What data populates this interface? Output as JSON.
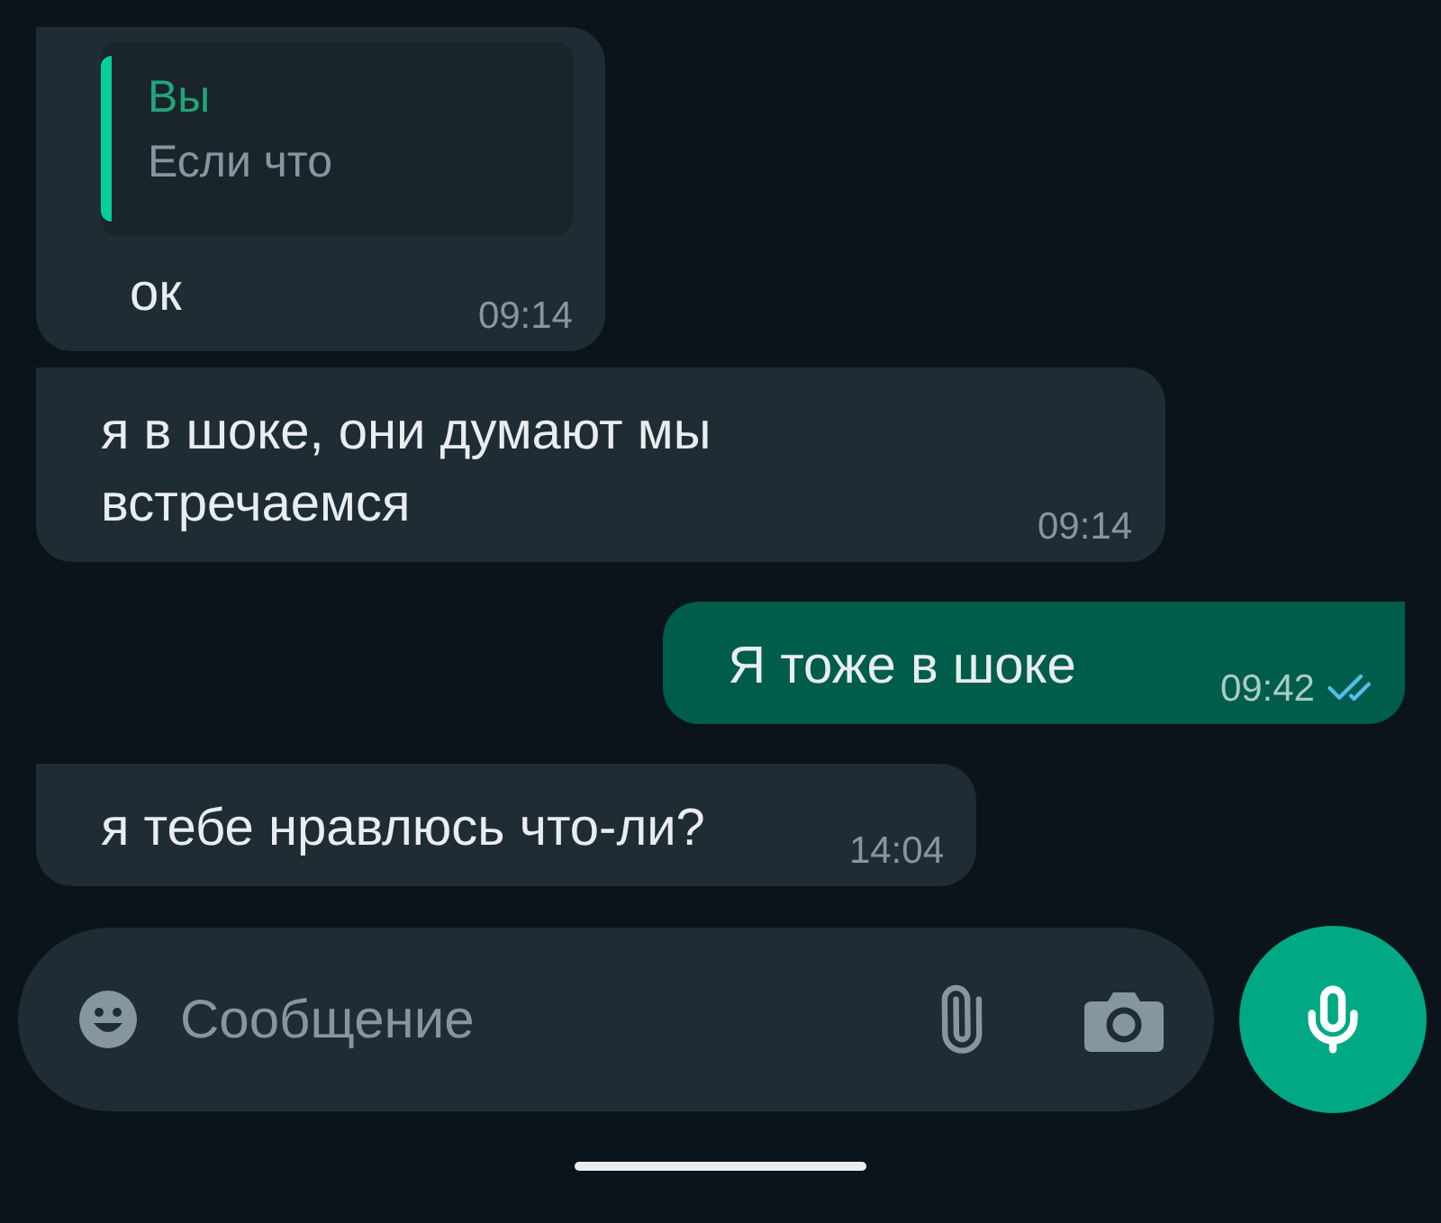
{
  "messages": [
    {
      "kind": "incoming",
      "quote": {
        "author": "Вы",
        "text": "Если что"
      },
      "text": "ок",
      "time": "09:14"
    },
    {
      "kind": "incoming",
      "text": "я в шоке, они думают мы встречаемся",
      "time": "09:14"
    },
    {
      "kind": "outgoing",
      "text": "Я тоже в шоке",
      "time": "09:42",
      "read": true
    },
    {
      "kind": "incoming",
      "text": "я тебе нравлюсь что-ли?",
      "time": "14:04"
    }
  ],
  "composer": {
    "placeholder": "Сообщение"
  }
}
